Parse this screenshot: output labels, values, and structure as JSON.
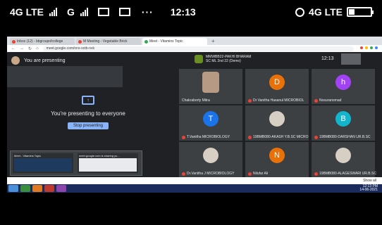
{
  "phone_status": {
    "network_left": "4G LTE",
    "network_mid": "G",
    "dots": "···",
    "time": "12:13",
    "network_right": "4G LTE"
  },
  "browser": {
    "tabs": [
      {
        "label": "Inbox (12) - bbgroupofcollege",
        "color": "#ea4335",
        "active": false
      },
      {
        "label": "M Meeting - Vegetable Brick",
        "color": "#ea4335",
        "active": false
      },
      {
        "label": "Meet - Vitamins Topic",
        "color": "#34a853",
        "active": true
      }
    ],
    "new_tab": "+",
    "url": "meet.google.com/nnx-oxtb-nvk",
    "ext_colors": [
      "#ea4335",
      "#fbbc04",
      "#34a853",
      "#4285f4"
    ]
  },
  "meet": {
    "presenting_header": "You are presenting",
    "presenting_to_everyone": "You're presenting to everyone",
    "stop_button": "Stop presenting",
    "meeting_title": "MMWBB22-PAKHI BHARAM SC ML 2nd 22 (Demo)",
    "meeting_time": "12:13",
    "participants": [
      {
        "name": "Chakraborty Mitra",
        "initial": "",
        "color": "#b69a83",
        "photo": true
      },
      {
        "name": "Dr Vanitha Hasanul MICROBIOL",
        "initial": "D",
        "color": "#e8710a",
        "photo": false
      },
      {
        "name": "Nosuranomad",
        "initial": "h",
        "color": "#a142f4",
        "photo": false
      },
      {
        "name": "T.Vanitha MICROBIOLOGY",
        "initial": "T",
        "color": "#1a73e8",
        "photo": false
      },
      {
        "name": "19BMB080-AKASH Y.B.SC MICRO",
        "initial": "",
        "color": "#d8cfc4",
        "photo": true
      },
      {
        "name": "19BMB080-DARSHAN UR.B.SC",
        "initial": "B",
        "color": "#12b5cb",
        "photo": false
      },
      {
        "name": "Dr.Vanitha J MICROBIOLOGY",
        "initial": "",
        "color": "#d8cfc4",
        "photo": true
      },
      {
        "name": "Nilufar Ali",
        "initial": "N",
        "color": "#e8710a",
        "photo": false
      },
      {
        "name": "19BMB080-ALAGESWARI UR.B.SC",
        "initial": "",
        "color": "#d8cfc4",
        "photo": true
      }
    ],
    "share_windows": [
      {
        "caption": "Meet - Vitamins Topic"
      },
      {
        "caption": "meet.google.com is sharing yo..."
      }
    ]
  },
  "downloads": {
    "show_all": "Show all"
  },
  "taskbar": {
    "apps": [
      "#4a90d9",
      "#3a8f3a",
      "#e07a1f",
      "#c0392b",
      "#8e44ad"
    ],
    "tray_time": "12:13 PM",
    "tray_date": "14-06-2021"
  }
}
